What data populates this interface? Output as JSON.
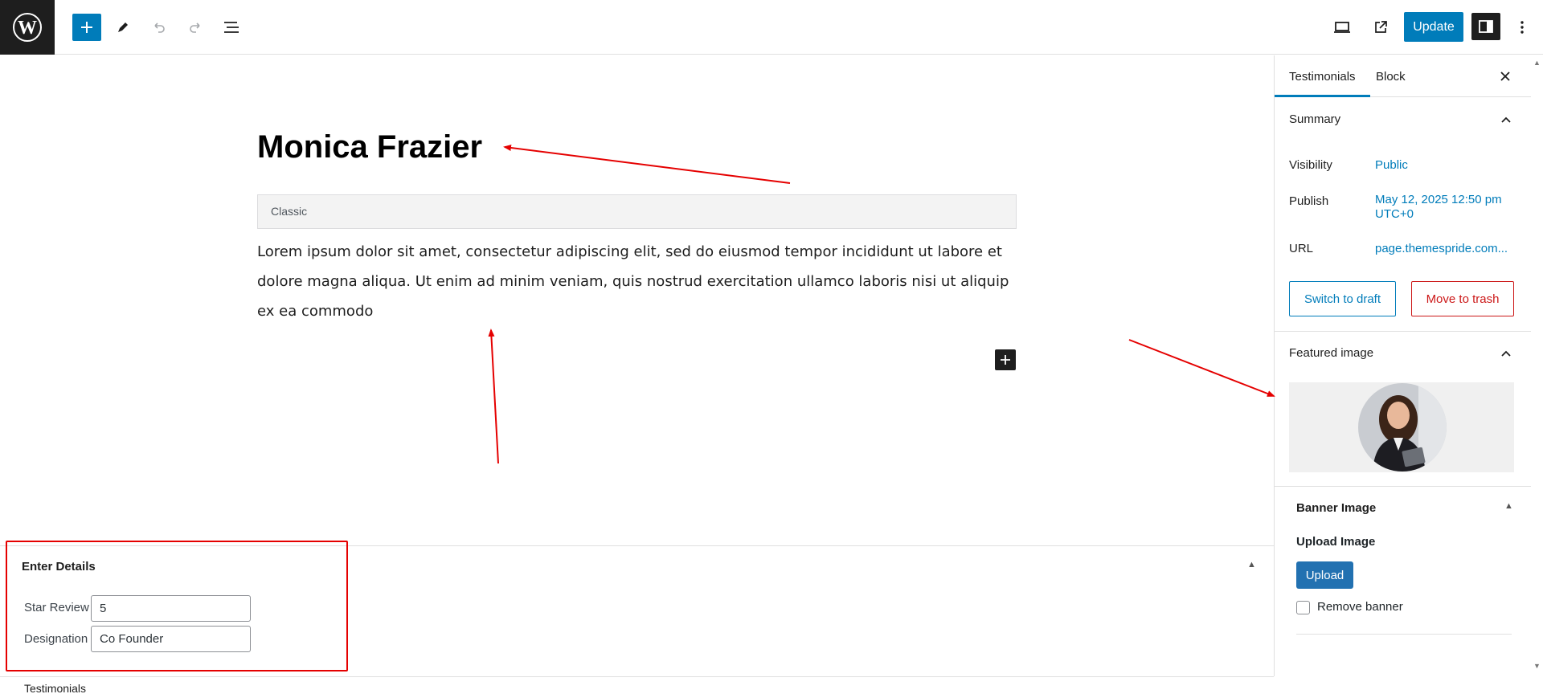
{
  "toolbar": {
    "update_label": "Update",
    "icons": [
      "wordpress-logo",
      "plus-icon",
      "pencil-icon",
      "undo-icon",
      "redo-icon",
      "list-view-icon",
      "desktop-view-icon",
      "external-preview-icon",
      "sidebar-toggle-icon",
      "more-vertical-icon"
    ]
  },
  "editor": {
    "title": "Monica Frazier",
    "classic_label": "Classic",
    "body": "Lorem ipsum dolor sit amet, consectetur adipiscing elit, sed do eiusmod tempor incididunt ut labore et dolore magna aliqua. Ut enim ad minim veniam, quis nostrud exercitation ullamco laboris nisi ut aliquip ex ea commodo"
  },
  "metabox": {
    "title": "Enter Details",
    "toggle": "▲",
    "star_review_label": "Star Review",
    "star_review_value": "5",
    "designation_label": "Designation",
    "designation_value": "Co Founder"
  },
  "footer": {
    "breadcrumb": "Testimonials"
  },
  "sidebar": {
    "tab_post": "Testimonials",
    "tab_block": "Block",
    "summary_title": "Summary",
    "visibility_label": "Visibility",
    "visibility_value": "Public",
    "publish_label": "Publish",
    "publish_value": "May 12, 2025 12:50 pm UTC+0",
    "url_label": "URL",
    "url_value": "page.themespride.com...",
    "switch_draft": "Switch to draft",
    "move_trash": "Move to trash",
    "featured_title": "Featured image",
    "banner_title": "Banner Image",
    "banner_toggle": "▲",
    "upload_label": "Upload Image",
    "upload_button": "Upload",
    "remove_banner": "Remove banner"
  },
  "colors": {
    "accent": "#007cba",
    "danger": "#cc1818",
    "annotation": "#e50000"
  }
}
